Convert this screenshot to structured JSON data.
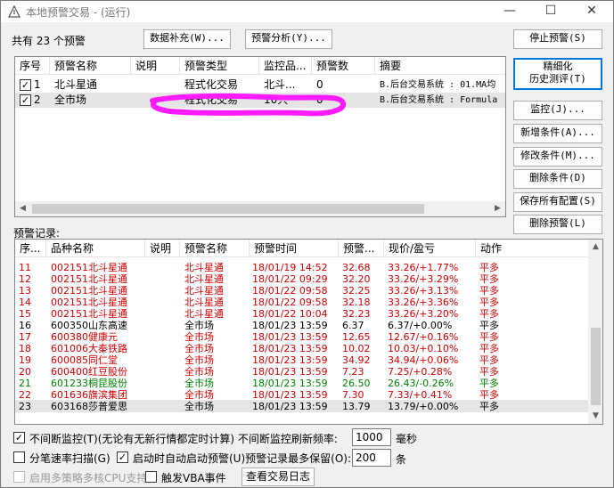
{
  "window": {
    "title": "本地预警交易 - (运行)",
    "icon": "app-triangle-icon",
    "controls": [
      "—",
      "☐",
      "✕"
    ]
  },
  "summary": "共有 23 个预警",
  "top_buttons": {
    "data_supplement": "数据补充(W)...",
    "alert_analysis": "预警分析(Y)..."
  },
  "alert_list": {
    "columns": [
      "序号",
      "预警名称",
      "说明",
      "预警类型",
      "监控品...",
      "预警数",
      "摘要"
    ],
    "rows": [
      {
        "checked": true,
        "no": "1",
        "name": "北斗星通",
        "desc": "",
        "type": "程式化交易",
        "monitor": "北斗...",
        "count": "0",
        "summary": "B.后台交易系统 : 01.MA均"
      },
      {
        "checked": true,
        "no": "2",
        "name": "全市场",
        "desc": "",
        "type": "程式化交易",
        "monitor": "10只",
        "count": "0",
        "summary": "B.后台交易系统 : Formula"
      }
    ],
    "annotation_color": "#ff1aff"
  },
  "side_buttons": {
    "stop_alert": "停止预警(S)",
    "refine_line1": "精细化",
    "refine_line2": "历史测评(T)",
    "monitor": "监控(J)...",
    "add_condition": "新增条件(A)...",
    "edit_condition": "修改条件(M)...",
    "delete_condition": "删除条件(D)",
    "save_config": "保存所有配置(S)",
    "delete_alert": "删除预警(L)"
  },
  "records_label": "预警记录:",
  "records": {
    "columns": [
      "序...",
      "品种名称",
      "说明",
      "预警名称",
      "预警时间",
      "预警...",
      "现价/盈亏",
      "动作"
    ],
    "rows": [
      {
        "no": "11",
        "code": "002151",
        "name": "北斗星通",
        "alert": "北斗星通",
        "time": "18/01/19 14:52",
        "price": "32.68",
        "pnl": "33.26/+1.77%",
        "action": "平多",
        "color": "red"
      },
      {
        "no": "12",
        "code": "002151",
        "name": "北斗星通",
        "alert": "北斗星通",
        "time": "18/01/22 09:29",
        "price": "32.20",
        "pnl": "33.26/+3.29%",
        "action": "平多",
        "color": "red"
      },
      {
        "no": "13",
        "code": "002151",
        "name": "北斗星通",
        "alert": "北斗星通",
        "time": "18/01/22 09:58",
        "price": "32.25",
        "pnl": "33.26/+3.13%",
        "action": "平多",
        "color": "red"
      },
      {
        "no": "14",
        "code": "002151",
        "name": "北斗星通",
        "alert": "北斗星通",
        "time": "18/01/22 09:58",
        "price": "32.18",
        "pnl": "33.26/+3.36%",
        "action": "平多",
        "color": "red"
      },
      {
        "no": "15",
        "code": "002151",
        "name": "北斗星通",
        "alert": "北斗星通",
        "time": "18/01/22 10:04",
        "price": "32.23",
        "pnl": "33.26/+3.20%",
        "action": "平多",
        "color": "red"
      },
      {
        "no": "16",
        "code": "600350",
        "name": "山东高速",
        "alert": "全市场",
        "time": "18/01/23 13:59",
        "price": "6.37",
        "pnl": "6.37/+0.00%",
        "action": "平多",
        "color": "blk"
      },
      {
        "no": "17",
        "code": "600380",
        "name": "健康元",
        "alert": "全市场",
        "time": "18/01/23 13:59",
        "price": "12.65",
        "pnl": "12.67/+0.16%",
        "action": "平多",
        "color": "red"
      },
      {
        "no": "18",
        "code": "601006",
        "name": "大秦铁路",
        "alert": "全市场",
        "time": "18/01/23 13:59",
        "price": "10.02",
        "pnl": "10.03/+0.10%",
        "action": "平多",
        "color": "red"
      },
      {
        "no": "19",
        "code": "600085",
        "name": "同仁堂",
        "alert": "全市场",
        "time": "18/01/23 13:59",
        "price": "34.92",
        "pnl": "34.94/+0.06%",
        "action": "平多",
        "color": "red"
      },
      {
        "no": "20",
        "code": "600400",
        "name": "红豆股份",
        "alert": "全市场",
        "time": "18/01/23 13:59",
        "price": "7.23",
        "pnl": "7.25/+0.28%",
        "action": "平多",
        "color": "red"
      },
      {
        "no": "21",
        "code": "601233",
        "name": "桐昆股份",
        "alert": "全市场",
        "time": "18/01/23 13:59",
        "price": "26.50",
        "pnl": "26.43/-0.26%",
        "action": "平多",
        "color": "green"
      },
      {
        "no": "22",
        "code": "601636",
        "name": "旗滨集团",
        "alert": "全市场",
        "time": "18/01/23 13:59",
        "price": "7.30",
        "pnl": "7.33/+0.41%",
        "action": "平多",
        "color": "red"
      },
      {
        "no": "23",
        "code": "603168",
        "name": "莎普爱思",
        "alert": "全市场",
        "time": "18/01/23 13:59",
        "price": "13.79",
        "pnl": "13.79/+0.00%",
        "action": "平多",
        "color": "blk"
      }
    ]
  },
  "options": {
    "continuous_monitor": {
      "checked": true,
      "label": "不间断监控(T)(无论有无新行情都定时计算) 不间断监控刷新频率:",
      "value": "1000",
      "unit": "毫秒"
    },
    "tick_scan": {
      "checked": false,
      "label": "分笔速率扫描(G)"
    },
    "auto_start": {
      "checked": true,
      "label": "启动时自动启动预警(U)预警记录最多保留(O):",
      "value": "200",
      "unit": "条"
    },
    "multicore": {
      "checked": false,
      "label": "启用多策略多核CPU支持",
      "disabled": true
    },
    "vba_event": {
      "checked": false,
      "label": "触发VBA事件"
    },
    "view_log": "查看交易日志"
  }
}
